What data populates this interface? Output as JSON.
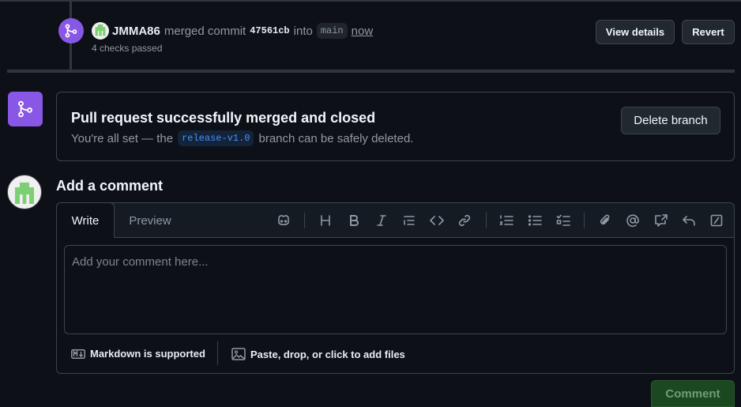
{
  "timeline_event": {
    "user": "JMMA86",
    "action": "merged commit",
    "commit_sha": "47561cb",
    "into_text": "into",
    "target_branch": "main",
    "time": "now",
    "checks": "4 checks passed",
    "view_details_label": "View details",
    "revert_label": "Revert"
  },
  "merge_status": {
    "title": "Pull request successfully merged and closed",
    "message_prefix": "You're all set — the",
    "branch": "release-v1.0",
    "message_suffix": "branch can be safely deleted.",
    "delete_branch_label": "Delete branch"
  },
  "comment": {
    "heading": "Add a comment",
    "tabs": {
      "write": "Write",
      "preview": "Preview"
    },
    "active_tab": "Write",
    "placeholder": "Add your comment here...",
    "value": "",
    "markdown_note": "Markdown is supported",
    "attach_note": "Paste, drop, or click to add files",
    "submit_label": "Comment"
  },
  "toolbar_icons": [
    "copilot-icon",
    "heading-icon",
    "bold-icon",
    "italic-icon",
    "quote-icon",
    "code-icon",
    "link-icon",
    "numbered-list-icon",
    "unordered-list-icon",
    "task-list-icon",
    "attach-icon",
    "mention-icon",
    "reference-icon",
    "reply-icon",
    "slash-command-icon"
  ],
  "colors": {
    "merged_purple": "#8957e5",
    "link_blue": "#4493f8",
    "comment_green_disabled": "#1b4721"
  }
}
